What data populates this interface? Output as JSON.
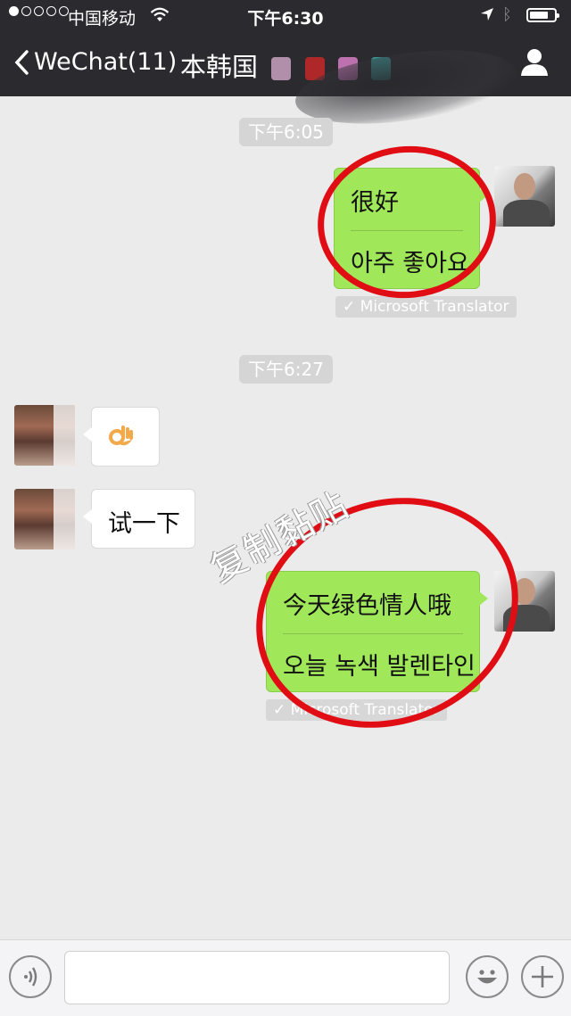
{
  "status_bar": {
    "signal_dots": 5,
    "signal_filled": 1,
    "carrier": "中国移动",
    "time": "下午6:30",
    "battery_level": 0.75
  },
  "nav": {
    "back_label": "WeChat(11)",
    "title": "本韩国"
  },
  "messages": [
    {
      "type": "timestamp",
      "text": "下午6:05"
    },
    {
      "type": "bubble",
      "sender": "me",
      "lines": [
        "很好",
        "아주 좋아요"
      ],
      "translation_tag": "✓ Microsoft Translator"
    },
    {
      "type": "timestamp",
      "text": "下午6:27"
    },
    {
      "type": "bubble",
      "sender": "other",
      "content": "ok-hand-emoji"
    },
    {
      "type": "bubble",
      "sender": "other",
      "text": "试一下"
    },
    {
      "type": "bubble",
      "sender": "me",
      "lines": [
        "今天绿色情人哦",
        "오늘 녹색 발렌타인"
      ],
      "translation_tag": "✓ Microsoft Translator"
    }
  ],
  "watermark": "复制黏贴",
  "input_bar": {
    "voice_icon": "voice-icon",
    "emoji_icon": "emoji-icon",
    "plus_icon": "plus-icon",
    "value": ""
  },
  "colors": {
    "top_bar": "#2b2b2f",
    "chat_bg": "#ebebeb",
    "sent_bubble": "#a0e75a",
    "annotation_red": "#e10d14"
  }
}
